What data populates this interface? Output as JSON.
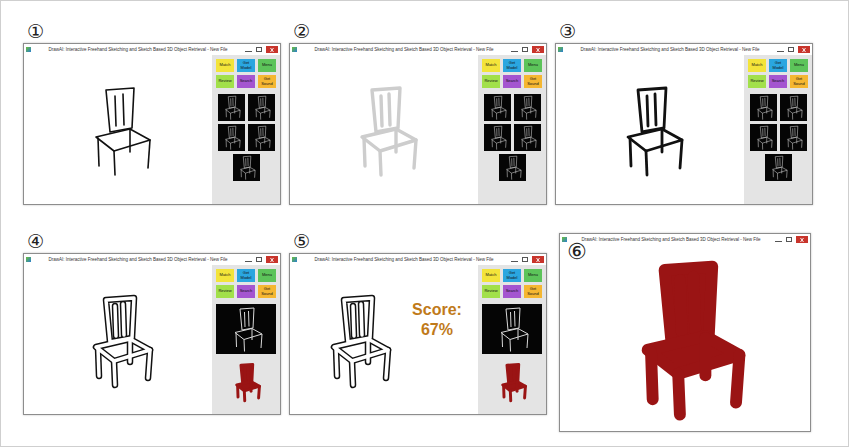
{
  "figure": {
    "panels": [
      {
        "number": "①",
        "kind": "rough",
        "retrieved": false,
        "window": {
          "title": "DrawAI: Interactive Freehand Sketching and Sketch Based 3D Object Retrieval - New File"
        }
      },
      {
        "number": "②",
        "kind": "faint",
        "retrieved": false,
        "window": {
          "title": "DrawAI: Interactive Freehand Sketching and Sketch Based 3D Object Retrieval - New File"
        }
      },
      {
        "number": "③",
        "kind": "smooth",
        "retrieved": false,
        "window": {
          "title": "DrawAI: Interactive Freehand Sketching and Sketch Based 3D Object Retrieval - New File"
        }
      },
      {
        "number": "④",
        "kind": "outline",
        "retrieved": true,
        "window": {
          "title": "DrawAI: Interactive Freehand Sketching and Sketch Based 3D Object Retrieval - New File"
        }
      },
      {
        "number": "⑤",
        "kind": "outline",
        "retrieved": true,
        "window": {
          "title": "DrawAI: Interactive Freehand Sketching and Sketch Based 3D Object Retrieval - New File"
        },
        "score": {
          "label": "Score:",
          "value": "67%"
        }
      },
      {
        "number": "⑥",
        "kind": "model",
        "retrieved": true,
        "window": {
          "title": "DrawAI: Interactive Freehand Sketching and Sketch Based 3D Object Retrieval - New File"
        }
      }
    ],
    "toolbar_buttons": [
      {
        "label": "Match",
        "color": "#f3e43a"
      },
      {
        "label": "Get Model",
        "color": "#2aa6e0"
      },
      {
        "label": "Menu",
        "color": "#5cc45a"
      },
      {
        "label": "Review",
        "color": "#a2e04a"
      },
      {
        "label": "Search",
        "color": "#a455d0"
      },
      {
        "label": "Get Sound",
        "color": "#f5b731"
      }
    ]
  }
}
